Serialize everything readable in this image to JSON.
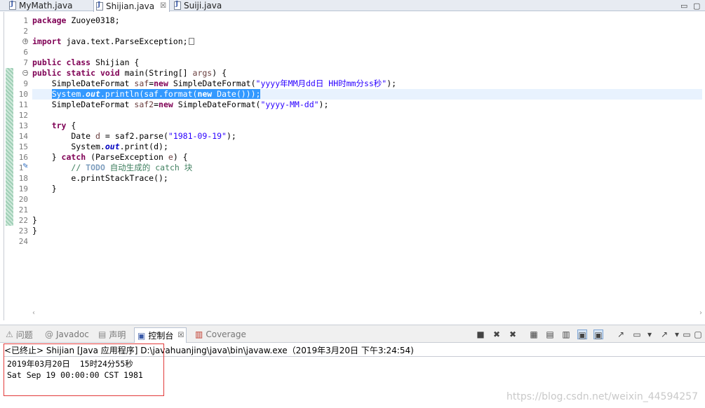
{
  "editor_tabs": [
    {
      "label": "MyMath.java",
      "active": false
    },
    {
      "label": "Shijian.java",
      "active": true
    },
    {
      "label": "Suiji.java",
      "active": false
    }
  ],
  "tab_close_glyph": "☒",
  "window_controls": {
    "minimize": "▭",
    "maximize": "▢"
  },
  "line_numbers": [
    "1",
    "2",
    "3",
    "6",
    "7",
    "8",
    "9",
    "10",
    "11",
    "12",
    "13",
    "14",
    "15",
    "16",
    "17",
    "18",
    "19",
    "20",
    "21",
    "22",
    "23",
    "24"
  ],
  "code": {
    "l1_kw": "package",
    "l1_rest": " Zuoye0318;",
    "l3_kw": "import",
    "l3_rest": " java.text.ParseException;",
    "l7_kw1": "public",
    "l7_kw2": "class",
    "l7_rest": " Shijian {",
    "l8_kw1": "public",
    "l8_kw2": "static",
    "l8_kw3": "void",
    "l8_a": " main(String[] ",
    "l8_var": "args",
    "l8_b": ") {",
    "l9_a": "    SimpleDateFormat ",
    "l9_var": "saf",
    "l9_eq": "=",
    "l9_kw": "new",
    "l9_b": " SimpleDateFormat(",
    "l9_str": "\"yyyy年MM月dd日 HH时mm分ss秒\"",
    "l9_c": ");",
    "l10_indent": "    ",
    "l10_a": "System.",
    "l10_fld": "out",
    "l10_b": ".println(saf.format(",
    "l10_kw": "new",
    "l10_c": " Date()));",
    "l11_a": "    SimpleDateFormat ",
    "l11_var": "saf2",
    "l11_eq": "=",
    "l11_kw": "new",
    "l11_b": " SimpleDateFormat(",
    "l11_str": "\"yyyy-MM-dd\"",
    "l11_c": ");",
    "l13_indent": "    ",
    "l13_kw": "try",
    "l13_rest": " {",
    "l14_a": "        Date ",
    "l14_var": "d",
    "l14_b": " = saf2.parse(",
    "l14_str": "\"1981-09-19\"",
    "l14_c": ");",
    "l15_a": "        System.",
    "l15_fld": "out",
    "l15_b": ".print(d);",
    "l16_a": "    } ",
    "l16_kw": "catch",
    "l16_b": " (ParseException ",
    "l16_var": "e",
    "l16_c": ") {",
    "l17_indent": "        ",
    "l17_slash": "// ",
    "l17_todo": "TODO",
    "l17_rest": " 自动生成的 catch 块",
    "l18": "        e.printStackTrace();",
    "l19": "    }",
    "l22": "}",
    "l23": "}"
  },
  "view_tabs": [
    {
      "label": "问题",
      "icon": "problems-icon",
      "glyph": "⚠"
    },
    {
      "label": "Javadoc",
      "icon": "javadoc-icon",
      "glyph": "@"
    },
    {
      "label": "声明",
      "icon": "declaration-icon",
      "glyph": "▤"
    },
    {
      "label": "控制台",
      "icon": "console-icon",
      "glyph": "▣",
      "active": true
    },
    {
      "label": "Coverage",
      "icon": "coverage-icon",
      "glyph": "▥"
    }
  ],
  "toolbar_glyphs": [
    "■",
    "✖",
    "✖",
    "▦",
    "▤",
    "▥",
    "▣",
    "▣",
    "↗",
    "▭",
    "▾",
    "↗",
    "▾",
    "▭",
    "▢"
  ],
  "console": {
    "header": "<已终止> Shijian [Java 应用程序] D:\\javahuanjing\\java\\bin\\javaw.exe（2019年3月20日 下午3:24:54)",
    "lines": [
      "2019年03月20日  15时24分55秒",
      "Sat Sep 19 00:00:00 CST 1981"
    ]
  },
  "watermark": "https://blog.csdn.net/weixin_44594257",
  "colors": {
    "keyword": "#7f0055",
    "string": "#2a00ff",
    "comment": "#3f7f5f",
    "selection": "#3399ff",
    "highlight_box": "#e23b3b"
  }
}
